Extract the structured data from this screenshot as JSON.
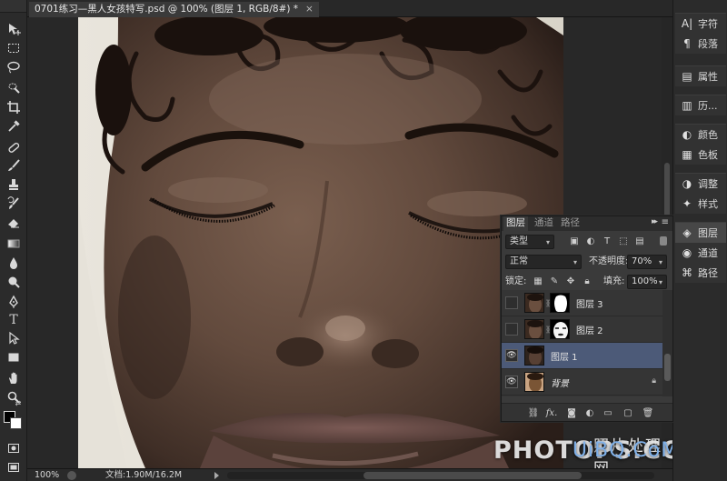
{
  "document": {
    "tab_title": "0701练习—黑人女孩特写.psd @ 100% (图层 1, RGB/8#) *",
    "tab_close": "×"
  },
  "toolbar": {
    "tools": [
      "move-tool",
      "rect-marquee-tool",
      "lasso-tool",
      "quick-select-tool",
      "crop-tool",
      "eyedropper-tool",
      "healing-brush-tool",
      "brush-tool",
      "clone-stamp-tool",
      "history-brush-tool",
      "eraser-tool",
      "gradient-tool",
      "blur-tool",
      "dodge-tool",
      "pen-tool",
      "type-tool",
      "path-select-tool",
      "shape-tool",
      "hand-tool",
      "zoom-tool"
    ],
    "type_glyph": "T",
    "colors": {
      "foreground": "#000000",
      "background": "#ffffff"
    }
  },
  "status": {
    "zoom": "100%",
    "doc_info": "文档:1.90M/16.2M"
  },
  "dock": {
    "groups": [
      {
        "items": [
          {
            "icon": "character-icon",
            "glyph": "A|",
            "label": "字符"
          },
          {
            "icon": "paragraph-icon",
            "glyph": "¶",
            "label": "段落"
          }
        ]
      },
      {
        "items": [
          {
            "icon": "properties-icon",
            "glyph": "▤",
            "label": "属性"
          }
        ]
      },
      {
        "items": [
          {
            "icon": "history-icon",
            "glyph": "▥",
            "label": "历..."
          }
        ]
      },
      {
        "items": [
          {
            "icon": "color-icon",
            "glyph": "◐",
            "label": "颜色"
          },
          {
            "icon": "swatches-icon",
            "glyph": "▦",
            "label": "色板"
          }
        ]
      },
      {
        "items": [
          {
            "icon": "adjustments-icon",
            "glyph": "◑",
            "label": "调整"
          },
          {
            "icon": "styles-icon",
            "glyph": "✦",
            "label": "样式"
          }
        ]
      },
      {
        "items": [
          {
            "icon": "layers-icon",
            "glyph": "◈",
            "label": "图层",
            "active": true
          },
          {
            "icon": "channels-icon",
            "glyph": "◉",
            "label": "通道"
          },
          {
            "icon": "paths-icon",
            "glyph": "⌘",
            "label": "路径"
          }
        ]
      }
    ]
  },
  "layers_panel": {
    "tabs": [
      "图层",
      "通道",
      "路径"
    ],
    "active_tab": "图层",
    "menu_glyph": "≡",
    "collapse_glyph": "▸▸",
    "filter_kind": "类型",
    "blend_mode": "正常",
    "opacity_label": "不透明度:",
    "opacity_value": "70%",
    "lock_label": "锁定:",
    "fill_label": "填充:",
    "fill_value": "100%",
    "layers": [
      {
        "name": "图层 3",
        "visible": false,
        "has_mask": true,
        "selected": false,
        "italic": false,
        "locked": false
      },
      {
        "name": "图层 2",
        "visible": false,
        "has_mask": true,
        "selected": false,
        "italic": false,
        "locked": false
      },
      {
        "name": "图层 1",
        "visible": true,
        "has_mask": false,
        "selected": true,
        "italic": false,
        "locked": false
      },
      {
        "name": "背景",
        "visible": true,
        "has_mask": false,
        "selected": false,
        "italic": true,
        "locked": true
      }
    ],
    "footer": [
      "link-icon",
      "fx-icon",
      "add-mask-icon",
      "adjustment-layer-icon",
      "group-icon",
      "new-layer-icon",
      "trash-icon"
    ],
    "footer_fx": "fx."
  },
  "watermark": {
    "cn": "照片处理网",
    "en_main": "PHOTOPS.COM",
    "en_blue": "UiBQ.CoM"
  },
  "colors": {
    "accent_selected": "#4c5a78",
    "ui_dark": "#2b2b2b"
  }
}
